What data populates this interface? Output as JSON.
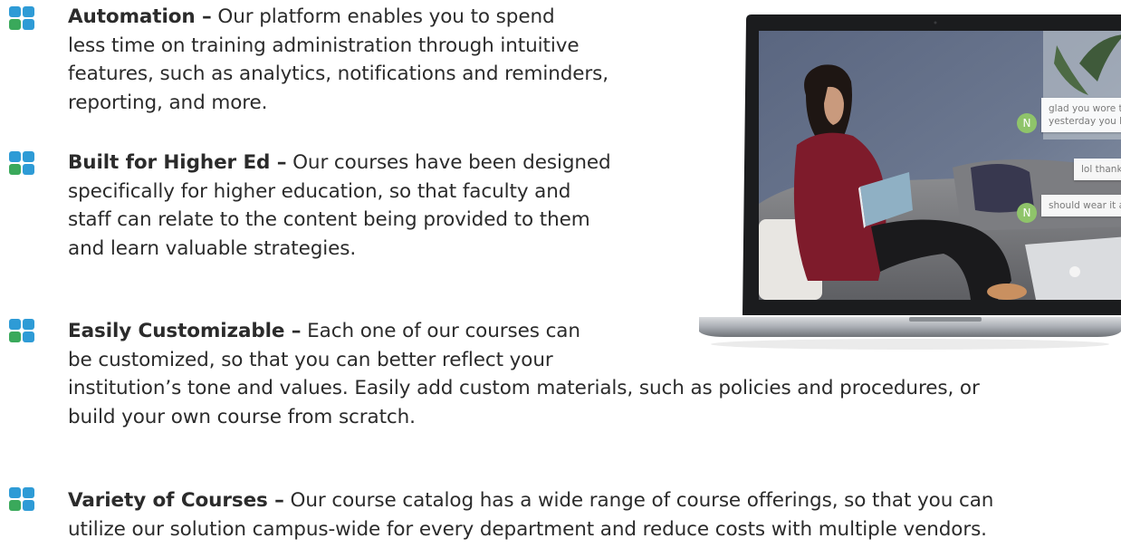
{
  "features": [
    {
      "title": "Automation –",
      "lines": [
        " Our platform enables you to spend",
        "less time on training administration through intuitive",
        "features, such as analytics, notifications and reminders,",
        "reporting, and more."
      ]
    },
    {
      "title": "Built for Higher Ed –",
      "lines": [
        " Our courses have been designed",
        "specifically for higher education, so that faculty and",
        "staff can relate to the content being provided to them",
        "and learn valuable strategies."
      ]
    },
    {
      "title": "Easily Customizable –",
      "lines": [
        " Each one of our courses can",
        "be customized, so that you can better reflect your",
        "institution’s tone and values. Easily add custom materials, such as policies and procedures, or",
        "build your own course from scratch."
      ]
    },
    {
      "title": "Variety of Courses –",
      "lines": [
        " Our course catalog has a wide range of course offerings, so that you can",
        "utilize our solution campus-wide for every department and reduce costs with multiple vendors."
      ]
    }
  ],
  "laptop_screen": {
    "chat": [
      {
        "lines": [
          "glad you wore tha",
          "yesterday you loo"
        ]
      },
      {
        "lines": [
          "lol thank"
        ]
      },
      {
        "lines": [
          "should wear it aga"
        ]
      }
    ],
    "avatar_letter": "N"
  },
  "colors": {
    "icon_blue": "#2e9bd6",
    "icon_green": "#3aa95b",
    "text": "#2b2b2b"
  },
  "icon_name": "four-squares-bullet-icon"
}
